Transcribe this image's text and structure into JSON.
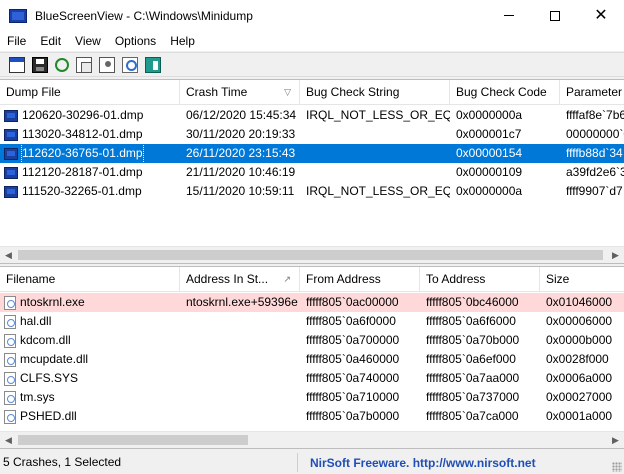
{
  "window": {
    "title": "BlueScreenView  -  C:\\Windows\\Minidump"
  },
  "menu": [
    "File",
    "Edit",
    "View",
    "Options",
    "Help"
  ],
  "toolbar": [
    "window-icon",
    "save-icon",
    "refresh-icon",
    "copy-icon",
    "properties-icon",
    "find-icon",
    "exit-icon"
  ],
  "crash_list": {
    "columns": [
      "Dump File",
      "Crash Time",
      "Bug Check String",
      "Bug Check Code",
      "Parameter"
    ],
    "sort_column": "Crash Time",
    "rows": [
      [
        "120620-30296-01.dmp",
        "06/12/2020 15:45:34",
        "IRQL_NOT_LESS_OR_EQ...",
        "0x0000000a",
        "ffffaf8e`7b6"
      ],
      [
        "113020-34812-01.dmp",
        "30/11/2020 20:19:33",
        "",
        "0x000001c7",
        "00000000`0"
      ],
      [
        "112620-36765-01.dmp",
        "26/11/2020 23:15:43",
        "",
        "0x00000154",
        "ffffb88d`34"
      ],
      [
        "112120-28187-01.dmp",
        "21/11/2020 10:46:19",
        "",
        "0x00000109",
        "a39fd2e6`3"
      ],
      [
        "111520-32265-01.dmp",
        "15/11/2020 10:59:11",
        "IRQL_NOT_LESS_OR_EQ...",
        "0x0000000a",
        "ffff9907`d7"
      ]
    ],
    "selected_row": 2
  },
  "driver_list": {
    "columns": [
      "Filename",
      "Address In St...",
      "From Address",
      "To Address",
      "Size"
    ],
    "rows": [
      [
        "ntoskrnl.exe",
        "ntoskrnl.exe+59396e",
        "fffff805`0ac00000",
        "fffff805`0bc46000",
        "0x01046000"
      ],
      [
        "hal.dll",
        "",
        "fffff805`0a6f0000",
        "fffff805`0a6f6000",
        "0x00006000"
      ],
      [
        "kdcom.dll",
        "",
        "fffff805`0a700000",
        "fffff805`0a70b000",
        "0x0000b000"
      ],
      [
        "mcupdate.dll",
        "",
        "fffff805`0a460000",
        "fffff805`0a6ef000",
        "0x0028f000"
      ],
      [
        "CLFS.SYS",
        "",
        "fffff805`0a740000",
        "fffff805`0a7aa000",
        "0x0006a000"
      ],
      [
        "tm.sys",
        "",
        "fffff805`0a710000",
        "fffff805`0a737000",
        "0x00027000"
      ],
      [
        "PSHED.dll",
        "",
        "fffff805`0a7b0000",
        "fffff805`0a7ca000",
        "0x0001a000"
      ]
    ],
    "highlighted_row": 0
  },
  "status": {
    "summary": "5 Crashes, 1 Selected",
    "link": "NirSoft Freeware.  http://www.nirsoft.net"
  }
}
